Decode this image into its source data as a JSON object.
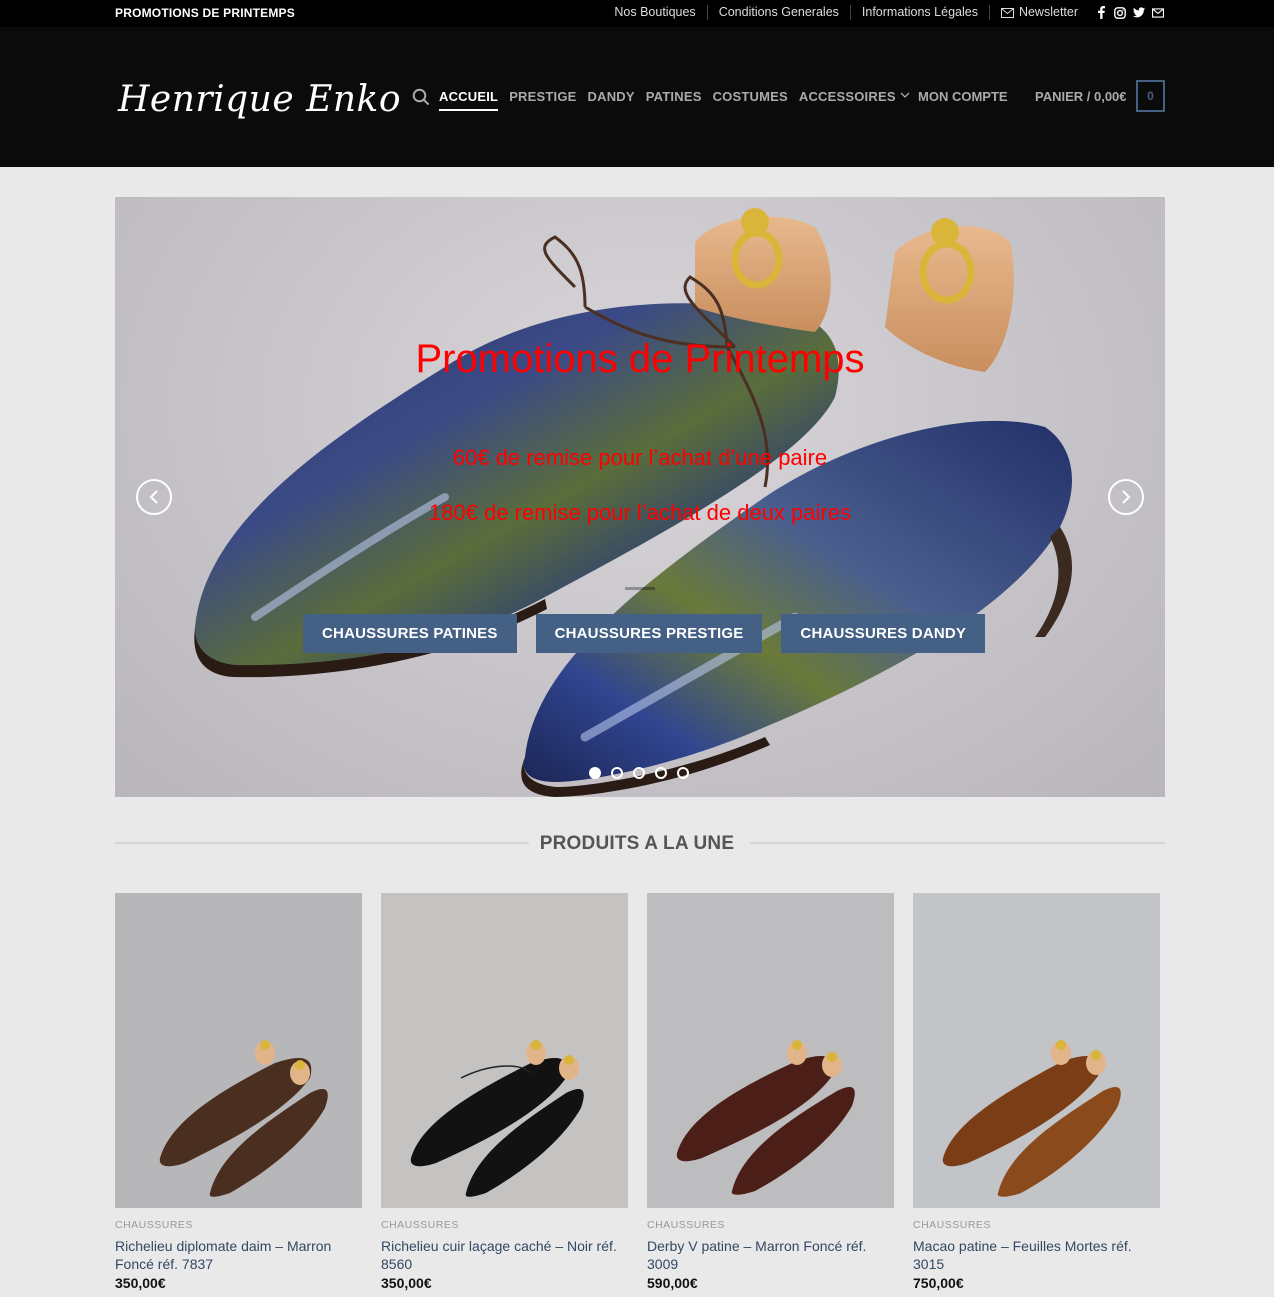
{
  "topbar": {
    "promo": "PROMOTIONS DE PRINTEMPS",
    "links": [
      "Nos Boutiques",
      "Conditions Generales",
      "Informations Légales"
    ],
    "newsletter": "Newsletter",
    "social_icons": [
      "facebook-icon",
      "instagram-icon",
      "twitter-icon",
      "mail-icon"
    ]
  },
  "header": {
    "logo": "Henrique Enko",
    "nav": [
      "ACCUEIL",
      "PRESTIGE",
      "DANDY",
      "PATINES",
      "COSTUMES",
      "ACCESSOIRES"
    ],
    "account": "MON COMPTE",
    "cart": "PANIER / 0,00€",
    "cart_count": "0"
  },
  "hero": {
    "title": "Promotions de Printemps",
    "line1": "60€ de remise pour l’achat d’une paire",
    "line2": "180€ de remise pour l’achat de deux paires",
    "buttons": [
      "CHAUSSURES PATINES",
      "CHAUSSURES PRESTIGE",
      "CHAUSSURES DANDY"
    ],
    "slide_count": 5,
    "active_slide": 1
  },
  "featured": {
    "title": "PRODUITS A LA UNE",
    "products": [
      {
        "category": "CHAUSSURES",
        "name": "Richelieu diplomate daim – Marron Foncé réf. 7837",
        "price": "350,00€",
        "color": "#4a2e1f"
      },
      {
        "category": "CHAUSSURES",
        "name": "Richelieu cuir laçage caché – Noir réf. 8560",
        "price": "350,00€",
        "color": "#121212"
      },
      {
        "category": "CHAUSSURES",
        "name": "Derby V patine – Marron Foncé réf. 3009",
        "price": "590,00€",
        "color": "#4b1f17"
      },
      {
        "category": "CHAUSSURES",
        "name": "Macao patine – Feuilles Mortes réf. 3015",
        "price": "750,00€",
        "color": "#7a3d16"
      }
    ]
  },
  "colors": {
    "accent": "#446084",
    "hero_text": "#ff0000"
  }
}
